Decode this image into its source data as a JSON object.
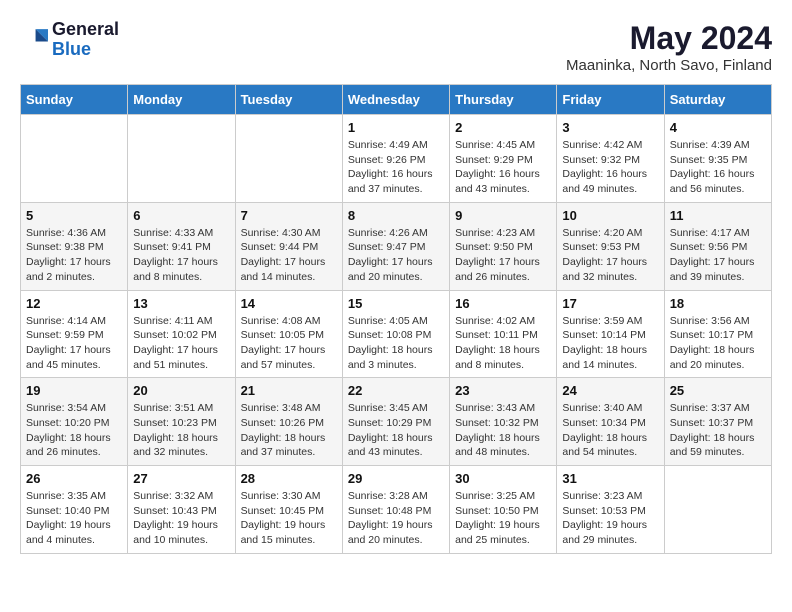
{
  "header": {
    "logo_general": "General",
    "logo_blue": "Blue",
    "month_year": "May 2024",
    "location": "Maaninka, North Savo, Finland"
  },
  "days_of_week": [
    "Sunday",
    "Monday",
    "Tuesday",
    "Wednesday",
    "Thursday",
    "Friday",
    "Saturday"
  ],
  "weeks": [
    [
      {
        "day": "",
        "info": ""
      },
      {
        "day": "",
        "info": ""
      },
      {
        "day": "",
        "info": ""
      },
      {
        "day": "1",
        "info": "Sunrise: 4:49 AM\nSunset: 9:26 PM\nDaylight: 16 hours and 37 minutes."
      },
      {
        "day": "2",
        "info": "Sunrise: 4:45 AM\nSunset: 9:29 PM\nDaylight: 16 hours and 43 minutes."
      },
      {
        "day": "3",
        "info": "Sunrise: 4:42 AM\nSunset: 9:32 PM\nDaylight: 16 hours and 49 minutes."
      },
      {
        "day": "4",
        "info": "Sunrise: 4:39 AM\nSunset: 9:35 PM\nDaylight: 16 hours and 56 minutes."
      }
    ],
    [
      {
        "day": "5",
        "info": "Sunrise: 4:36 AM\nSunset: 9:38 PM\nDaylight: 17 hours and 2 minutes."
      },
      {
        "day": "6",
        "info": "Sunrise: 4:33 AM\nSunset: 9:41 PM\nDaylight: 17 hours and 8 minutes."
      },
      {
        "day": "7",
        "info": "Sunrise: 4:30 AM\nSunset: 9:44 PM\nDaylight: 17 hours and 14 minutes."
      },
      {
        "day": "8",
        "info": "Sunrise: 4:26 AM\nSunset: 9:47 PM\nDaylight: 17 hours and 20 minutes."
      },
      {
        "day": "9",
        "info": "Sunrise: 4:23 AM\nSunset: 9:50 PM\nDaylight: 17 hours and 26 minutes."
      },
      {
        "day": "10",
        "info": "Sunrise: 4:20 AM\nSunset: 9:53 PM\nDaylight: 17 hours and 32 minutes."
      },
      {
        "day": "11",
        "info": "Sunrise: 4:17 AM\nSunset: 9:56 PM\nDaylight: 17 hours and 39 minutes."
      }
    ],
    [
      {
        "day": "12",
        "info": "Sunrise: 4:14 AM\nSunset: 9:59 PM\nDaylight: 17 hours and 45 minutes."
      },
      {
        "day": "13",
        "info": "Sunrise: 4:11 AM\nSunset: 10:02 PM\nDaylight: 17 hours and 51 minutes."
      },
      {
        "day": "14",
        "info": "Sunrise: 4:08 AM\nSunset: 10:05 PM\nDaylight: 17 hours and 57 minutes."
      },
      {
        "day": "15",
        "info": "Sunrise: 4:05 AM\nSunset: 10:08 PM\nDaylight: 18 hours and 3 minutes."
      },
      {
        "day": "16",
        "info": "Sunrise: 4:02 AM\nSunset: 10:11 PM\nDaylight: 18 hours and 8 minutes."
      },
      {
        "day": "17",
        "info": "Sunrise: 3:59 AM\nSunset: 10:14 PM\nDaylight: 18 hours and 14 minutes."
      },
      {
        "day": "18",
        "info": "Sunrise: 3:56 AM\nSunset: 10:17 PM\nDaylight: 18 hours and 20 minutes."
      }
    ],
    [
      {
        "day": "19",
        "info": "Sunrise: 3:54 AM\nSunset: 10:20 PM\nDaylight: 18 hours and 26 minutes."
      },
      {
        "day": "20",
        "info": "Sunrise: 3:51 AM\nSunset: 10:23 PM\nDaylight: 18 hours and 32 minutes."
      },
      {
        "day": "21",
        "info": "Sunrise: 3:48 AM\nSunset: 10:26 PM\nDaylight: 18 hours and 37 minutes."
      },
      {
        "day": "22",
        "info": "Sunrise: 3:45 AM\nSunset: 10:29 PM\nDaylight: 18 hours and 43 minutes."
      },
      {
        "day": "23",
        "info": "Sunrise: 3:43 AM\nSunset: 10:32 PM\nDaylight: 18 hours and 48 minutes."
      },
      {
        "day": "24",
        "info": "Sunrise: 3:40 AM\nSunset: 10:34 PM\nDaylight: 18 hours and 54 minutes."
      },
      {
        "day": "25",
        "info": "Sunrise: 3:37 AM\nSunset: 10:37 PM\nDaylight: 18 hours and 59 minutes."
      }
    ],
    [
      {
        "day": "26",
        "info": "Sunrise: 3:35 AM\nSunset: 10:40 PM\nDaylight: 19 hours and 4 minutes."
      },
      {
        "day": "27",
        "info": "Sunrise: 3:32 AM\nSunset: 10:43 PM\nDaylight: 19 hours and 10 minutes."
      },
      {
        "day": "28",
        "info": "Sunrise: 3:30 AM\nSunset: 10:45 PM\nDaylight: 19 hours and 15 minutes."
      },
      {
        "day": "29",
        "info": "Sunrise: 3:28 AM\nSunset: 10:48 PM\nDaylight: 19 hours and 20 minutes."
      },
      {
        "day": "30",
        "info": "Sunrise: 3:25 AM\nSunset: 10:50 PM\nDaylight: 19 hours and 25 minutes."
      },
      {
        "day": "31",
        "info": "Sunrise: 3:23 AM\nSunset: 10:53 PM\nDaylight: 19 hours and 29 minutes."
      },
      {
        "day": "",
        "info": ""
      }
    ]
  ]
}
